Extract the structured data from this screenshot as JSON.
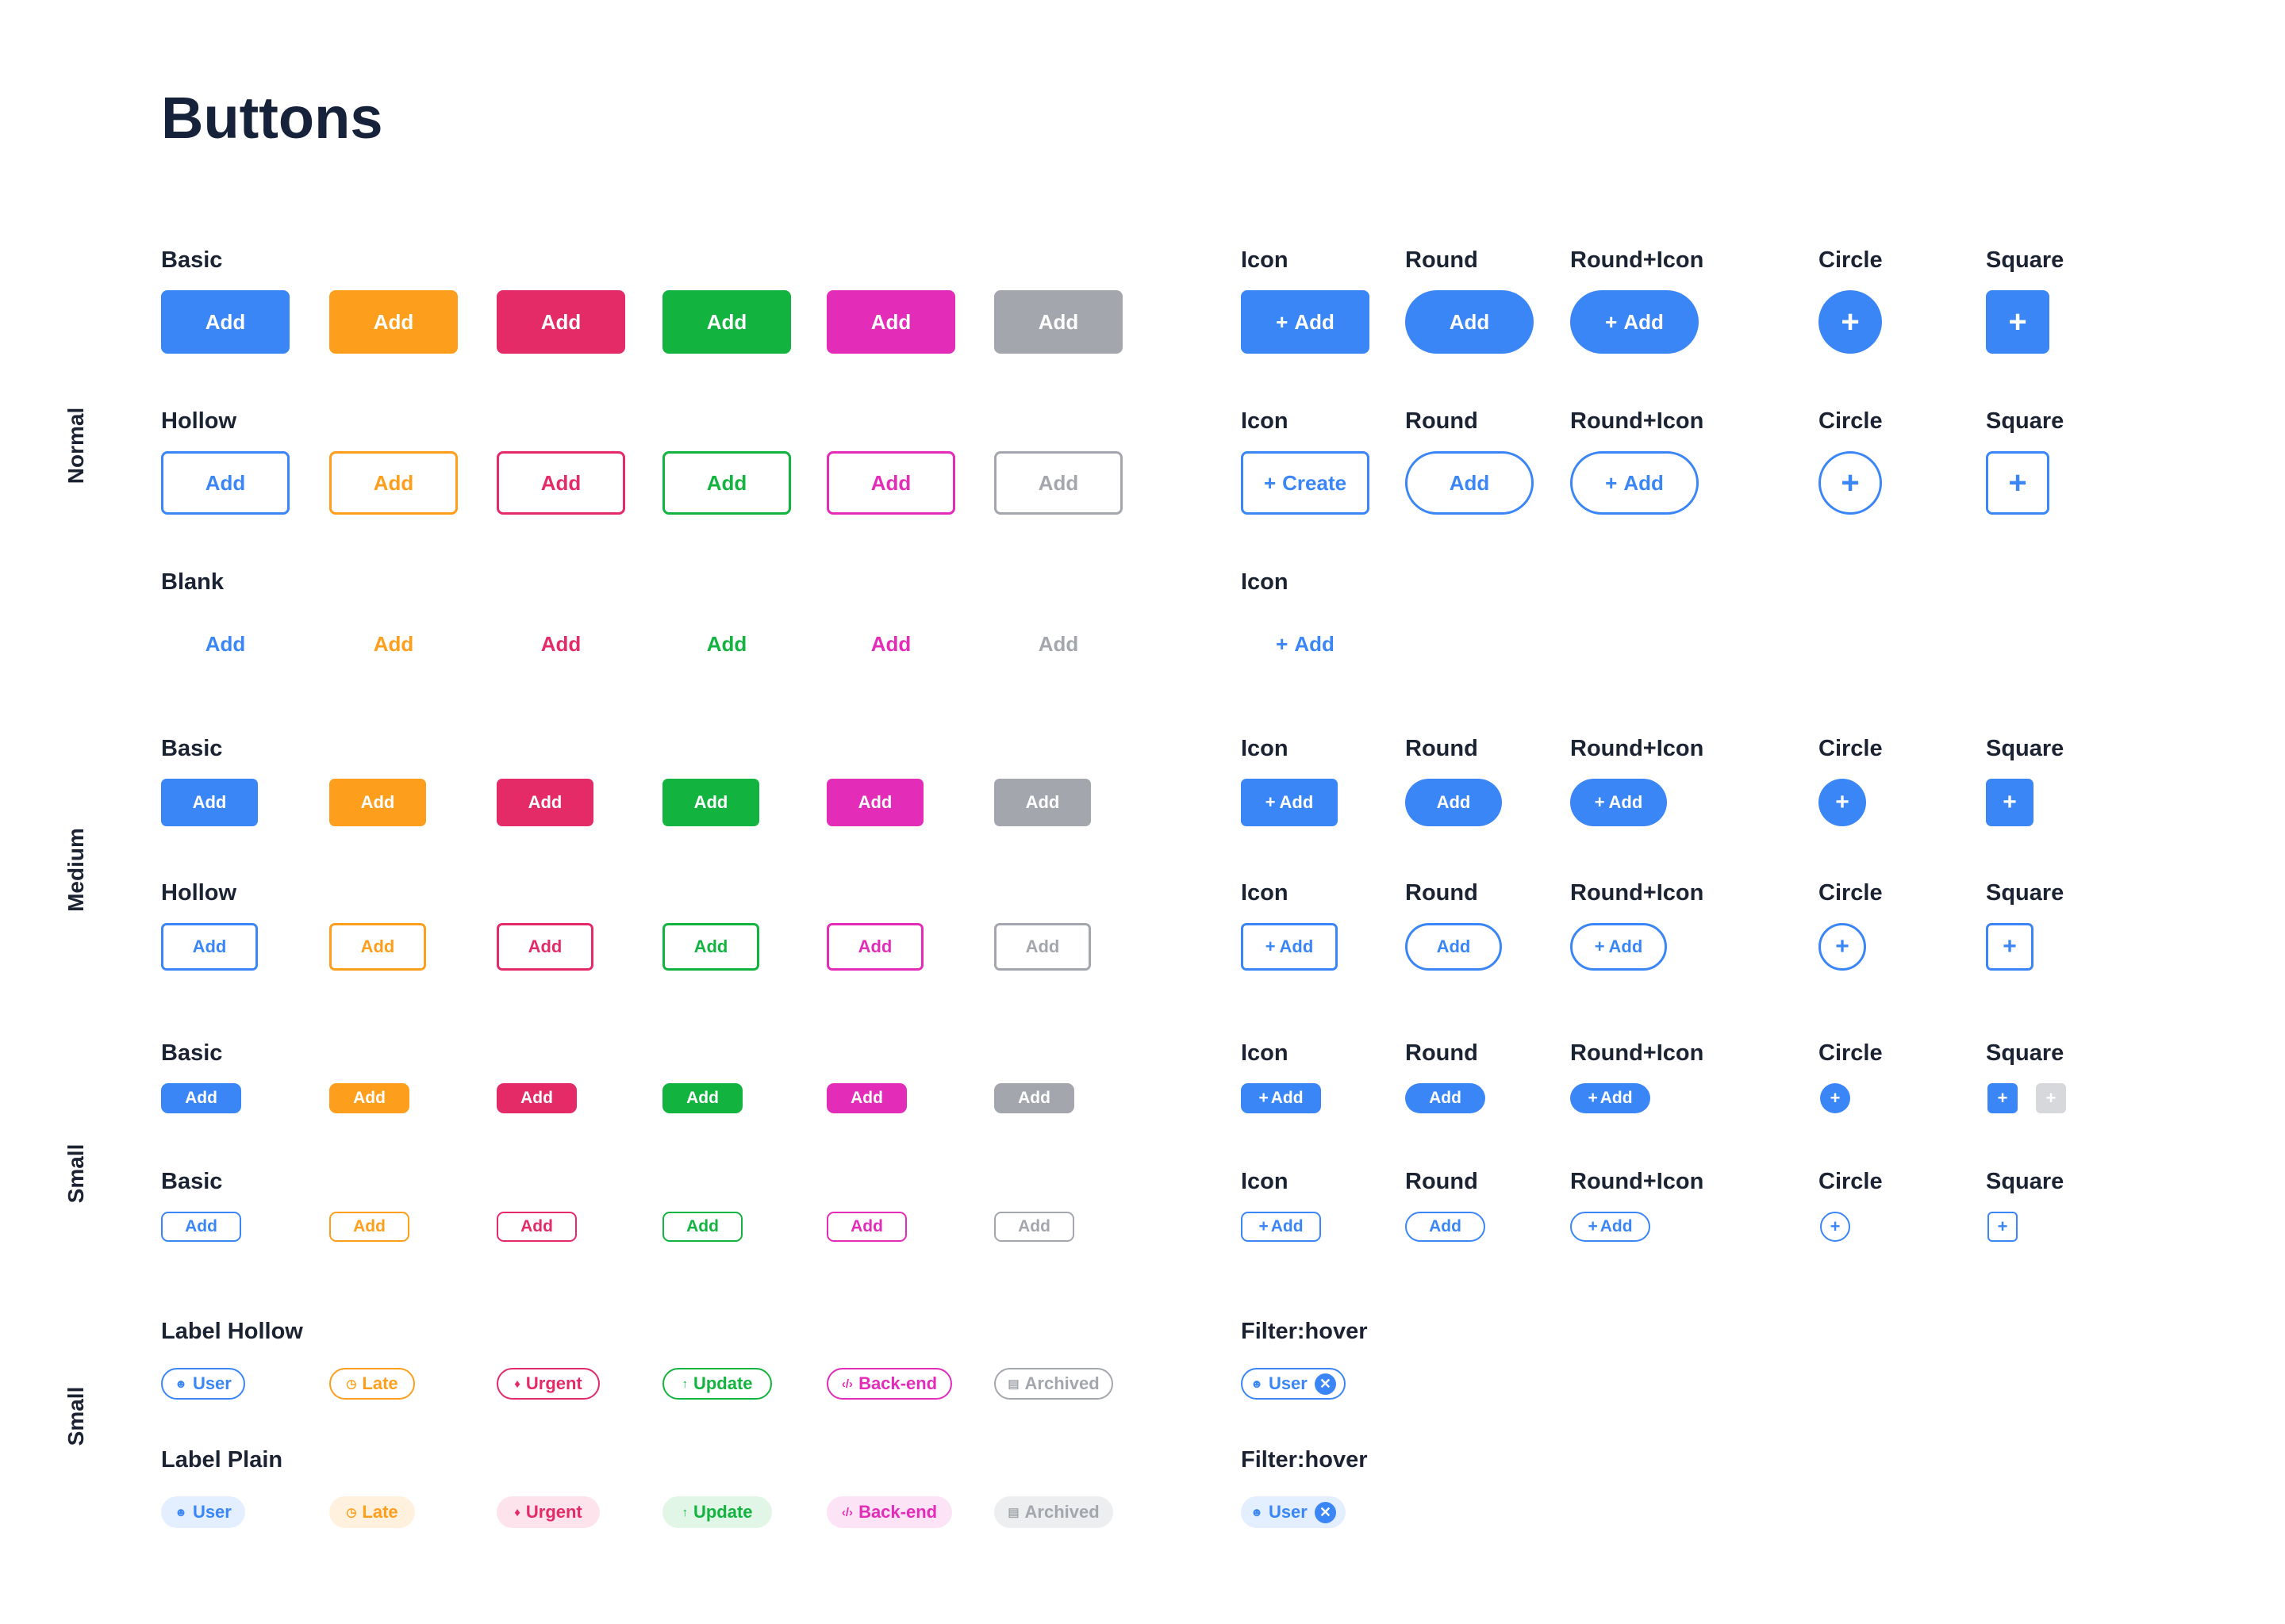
{
  "page": {
    "title": "Buttons"
  },
  "sections": {
    "normal": "Normal",
    "medium": "Medium",
    "small": "Small",
    "small_labels": "Small"
  },
  "groups": {
    "basic": "Basic",
    "hollow": "Hollow",
    "blank": "Blank",
    "icon": "Icon",
    "round": "Round",
    "round_icon": "Round+Icon",
    "circle": "Circle",
    "square": "Square",
    "label_hollow": "Label Hollow",
    "label_plain": "Label Plain",
    "filter_hover": "Filter:hover"
  },
  "buttons": {
    "add": "Add",
    "create": "Create",
    "plus": "+"
  },
  "colors": {
    "blue": "#3b86f7",
    "orange": "#fd9f1d",
    "red": "#e42b67",
    "green": "#12b43f",
    "pink": "#e32cb8",
    "gray": "#a3a7ad"
  },
  "labels": [
    {
      "text": "User",
      "icon": "user-icon",
      "color": "blue"
    },
    {
      "text": "Late",
      "icon": "clock-icon",
      "color": "orange"
    },
    {
      "text": "Urgent",
      "icon": "flame-icon",
      "color": "red"
    },
    {
      "text": "Update",
      "icon": "arrow-up-icon",
      "color": "green"
    },
    {
      "text": "Back-end",
      "icon": "code-icon",
      "color": "pink"
    },
    {
      "text": "Archived",
      "icon": "archive-icon",
      "color": "gray"
    }
  ],
  "filter": {
    "text": "User",
    "icon": "user-icon",
    "close_icon": "close-icon"
  }
}
